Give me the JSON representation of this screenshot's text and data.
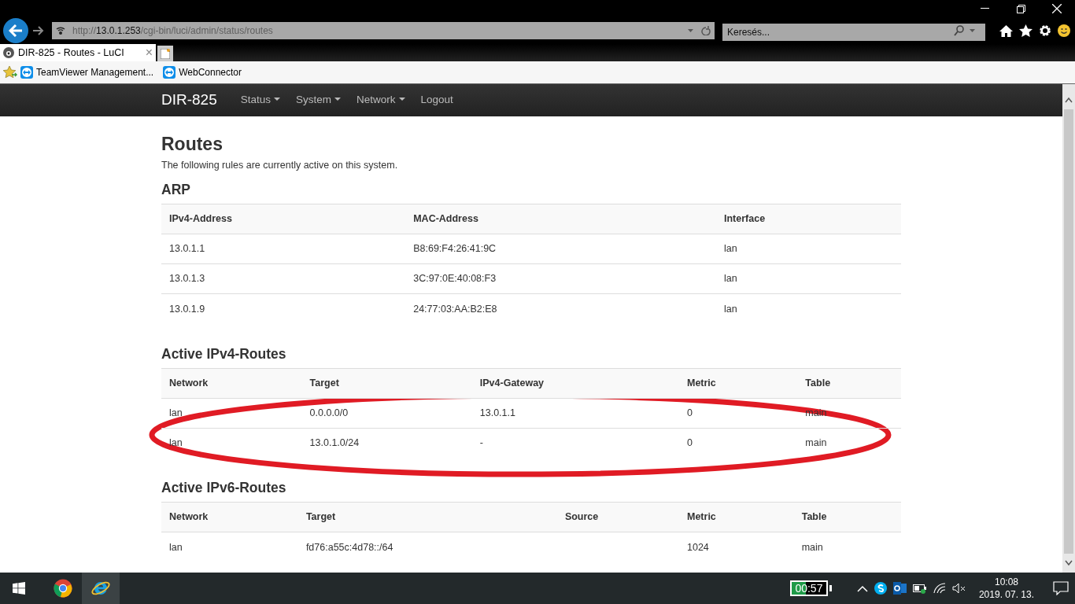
{
  "browser": {
    "address": {
      "scheme": "http://",
      "host": "13.0.1.253",
      "path": "/cgi-bin/luci/admin/status/routes"
    },
    "search": {
      "placeholder": "Keresés..."
    },
    "tabs": [
      {
        "label": "DIR-825 - Routes - LuCI",
        "close": "×",
        "selected": true
      }
    ],
    "favorites": [
      {
        "label": "TeamViewer Management..."
      },
      {
        "label": "WebConnector"
      }
    ]
  },
  "navbar": {
    "brand": "DIR-825",
    "items": [
      {
        "label": "Status",
        "kind": "dropdown"
      },
      {
        "label": "System",
        "kind": "dropdown"
      },
      {
        "label": "Network",
        "kind": "dropdown"
      },
      {
        "label": "Logout",
        "kind": "link"
      }
    ]
  },
  "page": {
    "title": "Routes",
    "description": "The following rules are currently active on this system.",
    "sections": [
      {
        "title": "ARP",
        "columns": [
          "IPv4-Address",
          "MAC-Address",
          "Interface"
        ],
        "rows": [
          [
            "13.0.1.1",
            "B8:69:F4:26:41:9C",
            "lan"
          ],
          [
            "13.0.1.3",
            "3C:97:0E:40:08:F3",
            "lan"
          ],
          [
            "13.0.1.9",
            "24:77:03:AA:B2:E8",
            "lan"
          ]
        ]
      },
      {
        "title": "Active IPv4-Routes",
        "highlighted": true,
        "columns": [
          "Network",
          "Target",
          "IPv4-Gateway",
          "Metric",
          "Table"
        ],
        "rows": [
          [
            "lan",
            "0.0.0.0/0",
            "13.0.1.1",
            "0",
            "main"
          ],
          [
            "lan",
            "13.0.1.0/24",
            "-",
            "0",
            "main"
          ]
        ]
      },
      {
        "title": "Active IPv6-Routes",
        "columns": [
          "Network",
          "Target",
          "Source",
          "Metric",
          "Table"
        ],
        "rows": [
          [
            "lan",
            "fd76:a55c:4d78::/64",
            "",
            "1024",
            "main"
          ]
        ]
      }
    ]
  },
  "taskbar": {
    "battery_timer": {
      "label": "00:57",
      "level": 0.42
    },
    "clock": {
      "time": "10:08",
      "date": "2019. 07. 13."
    }
  }
}
